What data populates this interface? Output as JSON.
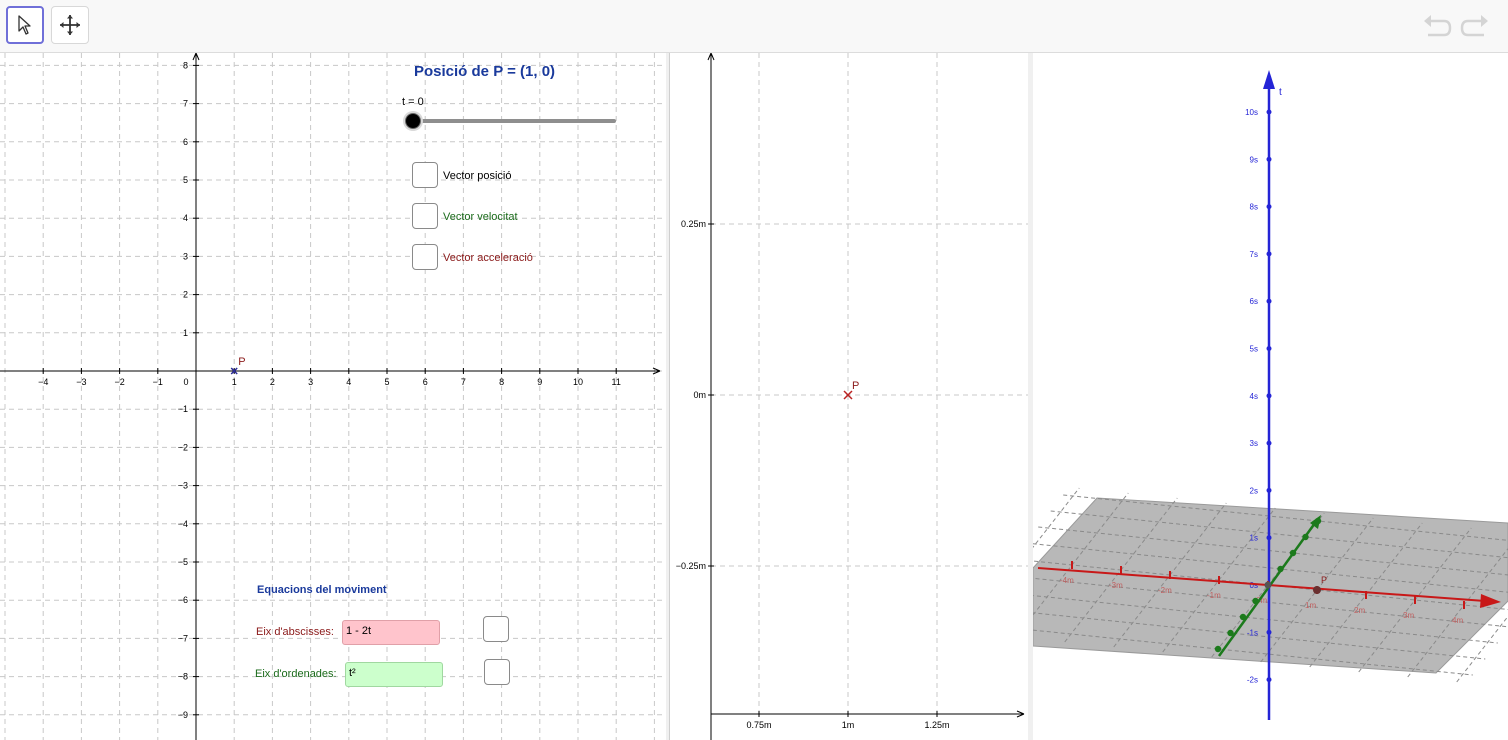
{
  "toolbar": {
    "tools": [
      {
        "name": "Move",
        "icon": "pointer-arrow-icon",
        "selected": true
      },
      {
        "name": "Move Graphics View",
        "icon": "move-arrows-icon",
        "selected": false
      }
    ],
    "undo_icon": "undo-icon",
    "redo_icon": "redo-icon"
  },
  "graphics1": {
    "title": "Posició de P = (1, 0)",
    "slider": {
      "label": "t = 0",
      "value": 0,
      "min": 0,
      "max": 10
    },
    "checkboxes": [
      {
        "label": "Vector posició",
        "color": "#000000",
        "checked": false
      },
      {
        "label": "Vector velocitat",
        "color": "#1b6b1b",
        "checked": false
      },
      {
        "label": "Vector acceleració",
        "color": "#8b1a1a",
        "checked": false
      }
    ],
    "equations": {
      "title": "Equacions del moviment",
      "x_label": "Eix d'abscisses:",
      "x_value": "1 - 2t",
      "y_label": "Eix d'ordenades:",
      "y_value": "t²"
    },
    "point": {
      "label": "P",
      "x": 1,
      "y": 0
    },
    "x_ticks": [
      "−4",
      "−3",
      "−2",
      "−1",
      "0",
      "1",
      "2",
      "3",
      "4",
      "5",
      "6",
      "7",
      "8",
      "9",
      "10",
      "11"
    ],
    "y_ticks_pos": [
      "1",
      "2",
      "3",
      "4",
      "5",
      "6",
      "7",
      "8"
    ],
    "y_ticks_neg": [
      "−1",
      "−2",
      "−3",
      "−4",
      "−5",
      "−6",
      "−7",
      "−8",
      "−9"
    ]
  },
  "graphics2": {
    "x_ticks": [
      "0.75m",
      "1m",
      "1.25m"
    ],
    "y_ticks": [
      "0.25m",
      "0m",
      "−0.25m"
    ],
    "point": {
      "label": "P",
      "x": 1,
      "y": 0
    }
  },
  "graphics3d": {
    "t_axis_label": "t",
    "t_ticks": [
      "10s",
      "9s",
      "8s",
      "7s",
      "6s",
      "5s",
      "4s",
      "3s",
      "2s",
      "1s",
      "0s",
      "-1s",
      "-2s"
    ],
    "x_ticks": [
      "-4m",
      "-3m",
      "-2m",
      "-1m",
      "0m",
      "1m",
      "2m",
      "3m",
      "4m"
    ],
    "point_label": "P",
    "colors": {
      "t_axis": "#2424d6",
      "x_axis": "#c81818",
      "y_axis": "#1c7a1c",
      "plane": "#b8b8b8"
    }
  }
}
